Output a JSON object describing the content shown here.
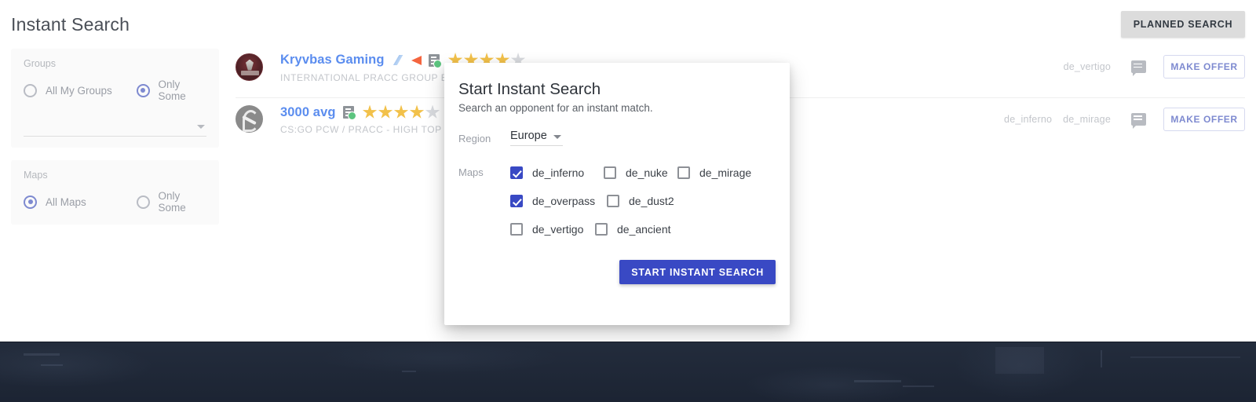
{
  "header": {
    "title": "Instant Search",
    "planned_search_label": "PLANNED SEARCH"
  },
  "sidebar": {
    "groups": {
      "label": "Groups",
      "options": [
        {
          "label": "All My Groups",
          "selected": false
        },
        {
          "label": "Only Some",
          "selected": true
        }
      ],
      "select_value": ""
    },
    "maps": {
      "label": "Maps",
      "options": [
        {
          "label": "All Maps",
          "selected": true
        },
        {
          "label": "Only Some",
          "selected": false
        }
      ]
    }
  },
  "results": {
    "rows": [
      {
        "name": "Kryvbas Gaming",
        "subtitle": "INTERNATIONAL PRACC GROUP  E",
        "stars_filled": 4,
        "stars_total": 5,
        "map_tags": [
          "de_vertigo"
        ],
        "offer_label": "MAKE OFFER"
      },
      {
        "name": "3000 avg",
        "subtitle": "CS:GO PCW / PRACC - HIGH   TOP",
        "stars_filled": 4,
        "stars_total": 5,
        "map_tags": [
          "de_inferno",
          "de_mirage"
        ],
        "offer_label": "MAKE OFFER"
      }
    ]
  },
  "modal": {
    "title": "Start Instant Search",
    "subtitle": "Search an opponent for an instant match.",
    "region_label": "Region",
    "region_value": "Europe",
    "maps_label": "Maps",
    "map_rows": [
      [
        {
          "label": "de_inferno",
          "checked": true
        },
        {
          "label": "de_nuke",
          "checked": false
        },
        {
          "label": "de_mirage",
          "checked": false
        }
      ],
      [
        {
          "label": "de_overpass",
          "checked": true
        },
        {
          "label": "de_dust2",
          "checked": false
        }
      ],
      [
        {
          "label": "de_vertigo",
          "checked": false
        },
        {
          "label": "de_ancient",
          "checked": false
        }
      ]
    ],
    "submit_label": "START INSTANT SEARCH"
  },
  "colors": {
    "accent_indigo": "#3949c4",
    "radio_indigo": "#7e8ad0",
    "link_blue": "#5b8def",
    "star_gold": "#f2c14a",
    "band_dark": "#1e2635"
  }
}
